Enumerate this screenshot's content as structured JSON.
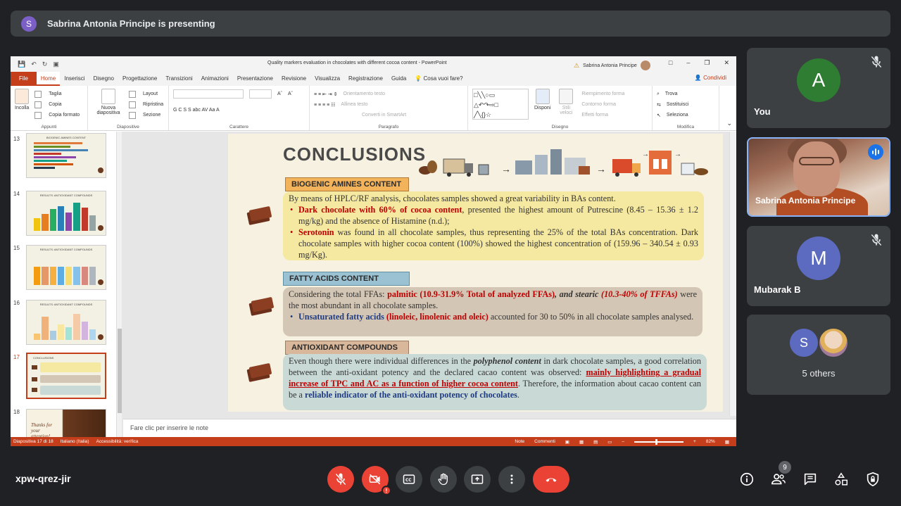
{
  "presenting_bar": {
    "avatar_letter": "S",
    "text": "Sabrina Antonia Principe is presenting"
  },
  "powerpoint": {
    "doc_title": "Quality markers evaluation in chocolates with different cocoa content  -  PowerPoint",
    "user_name": "Sabrina Antonia Principe",
    "tabs": [
      "File",
      "Home",
      "Inserisci",
      "Disegno",
      "Progettazione",
      "Transizioni",
      "Animazioni",
      "Presentazione",
      "Revisione",
      "Visualizza",
      "Registrazione",
      "Guida"
    ],
    "active_tab": "Home",
    "tell_me": "Cosa vuoi fare?",
    "share_label": "Condividi",
    "ribbon": {
      "appunti": {
        "label": "Appunti",
        "paste": "Incolla",
        "cut": "Taglia",
        "copy": "Copia",
        "format": "Copia formato"
      },
      "diapositive": {
        "label": "Diapositive",
        "new": "Nuova diapositiva",
        "layout": "Layout",
        "reset": "Ripristina",
        "section": "Sezione"
      },
      "carattere": {
        "label": "Carattere",
        "buttons": "G  C  S  S  abc  AV  Aa  A"
      },
      "paragrafo": {
        "label": "Paragrafo",
        "orient": "Orientamento testo",
        "align": "Allinea testo",
        "smartart": "Converti in SmartArt"
      },
      "disegno": {
        "label": "Disegno",
        "arrange": "Disponi",
        "styles": "Stili veloci",
        "fill": "Riempimento forma",
        "outline": "Contorno forma",
        "effects": "Effetti forma"
      },
      "modifica": {
        "label": "Modifica",
        "find": "Trova",
        "replace": "Sostituisci",
        "select": "Seleziona"
      }
    },
    "thumbnails": [
      {
        "num": "13",
        "title": "BIOGENIC AMINES CONTENT"
      },
      {
        "num": "14",
        "title": "RESULTS: ANTIOXIDANT COMPOUNDS"
      },
      {
        "num": "15",
        "title": "RESULTS: ANTIOXIDANT COMPOUNDS"
      },
      {
        "num": "16",
        "title": "RESULTS: ANTIOXIDANT COMPOUNDS"
      },
      {
        "num": "17",
        "title": "CONCLUSIONS"
      },
      {
        "num": "18",
        "title": "Thanks for your attention!"
      }
    ],
    "selected_slide": "17",
    "notes_placeholder": "Fare clic per inserire le note",
    "status": {
      "slide": "Diapositiva 17 di 18",
      "lang": "Italiano (Italia)",
      "access": "Accessibilità: verifica",
      "notes": "Note",
      "comments": "Commenti",
      "zoom": "82%"
    }
  },
  "slide": {
    "title": "CONCLUSIONS",
    "section1": {
      "label": "BIOGENIC AMINES CONTENT",
      "intro": "By means of HPLC/RF analysis, chocolates samples showed a great variability in BAs content.",
      "b1_strong": "Dark chocolate with 60% of cocoa content",
      "b1_rest": ", presented the highest amount of Putrescine (8.45 – 15.36 ± 1.2 mg/kg) and the absence of Histamine (n.d.);",
      "b2_strong": "Serotonin",
      "b2_rest": " was found in all chocolate samples, thus representing the 25% of the total BAs concentration. Dark chocolate samples with higher cocoa content (100%) showed the highest concentration of (159.96 – 340.54 ± 0.93 mg/Kg)."
    },
    "section2": {
      "label": "FATTY ACIDS CONTENT",
      "intro_a": "Considering the total FFAs: ",
      "intro_red": "palmitic (10.9-31.9% Total of analyzed FFAs)",
      "intro_and": ", and stearic ",
      "intro_it": "(10.3-40% of TFFAs)",
      "intro_rest": " were the most abundant in all chocolate samples.",
      "b1_blue": "Unsaturated fatty acids",
      "b1_red": "(linoleic, linolenic and oleic)",
      "b1_rest": " accounted for 30 to 50% in all chocolate samples analysed."
    },
    "section3": {
      "label": "ANTIOXIDANT COMPOUNDS",
      "t1": "Even though there were individual differences in the ",
      "t1_it": "polyphenol content",
      "t1_rest": " in dark chocolate samples, a good correlation between the anti-oxidant potency and the declared cacao content was observed: ",
      "t_red": "mainly highlighting a gradual increase of TPC and AC as a function of higher cocoa content",
      "t2": ". Therefore, the information about cacao content can be a ",
      "t_blue": "reliable indicator of the anti-oxidant potency of chocolates",
      "t3": "."
    }
  },
  "participants": [
    {
      "name": "You",
      "initial": "A",
      "color": "#2e7d32",
      "muted": true
    },
    {
      "name": "Sabrina Antonia Principe",
      "speaking": true
    },
    {
      "name": "Mubarak B",
      "initial": "M",
      "color": "#5c6bc0",
      "muted": true
    },
    {
      "name": "5 others",
      "initial": "S"
    }
  ],
  "bottom": {
    "meeting_code": "xpw-qrez-jir",
    "people_count": "9",
    "alert_badge": "!"
  }
}
